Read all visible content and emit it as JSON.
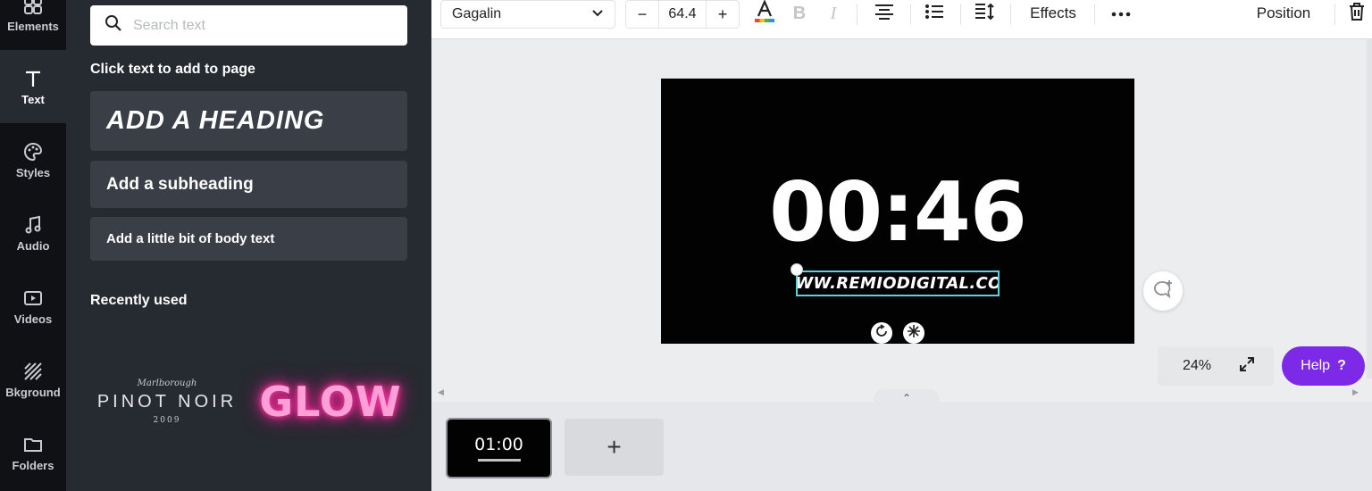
{
  "rail": {
    "items": [
      {
        "label": "Elements",
        "icon": "elements-icon"
      },
      {
        "label": "Text",
        "icon": "text-icon"
      },
      {
        "label": "Styles",
        "icon": "palette-icon"
      },
      {
        "label": "Audio",
        "icon": "music-note-icon"
      },
      {
        "label": "Videos",
        "icon": "video-icon"
      },
      {
        "label": "Bkground",
        "icon": "background-icon"
      },
      {
        "label": "Folders",
        "icon": "folder-icon"
      }
    ],
    "active": "Text"
  },
  "panel": {
    "search_placeholder": "Search text",
    "click_text_heading": "Click text to add to page",
    "add_heading": "ADD A HEADING",
    "add_subheading": "Add a subheading",
    "add_body": "Add a little bit of body text",
    "recently_used": "Recently used",
    "recent_items": {
      "pinot_small": "Marlborough",
      "pinot_big": "PINOT NOIR",
      "pinot_year": "2009",
      "glow": "GLOW"
    }
  },
  "toolbar": {
    "font_name": "Gagalin",
    "font_size": "64.4",
    "effects_label": "Effects",
    "position_label": "Position",
    "text_color_bar": "rainbow"
  },
  "canvas": {
    "timer_text": "00:46",
    "url_text": "WWW.REMIODIGITAL.COM",
    "background_color": "#020202"
  },
  "zoom": {
    "value": "24%"
  },
  "help": {
    "label": "Help",
    "icon_text": "?"
  },
  "timeline": {
    "page_duration": "01:00",
    "add_page_label": "+"
  },
  "colors": {
    "accent": "#7d2ae8",
    "selection": "#5fd0dc",
    "panel_bg": "#262a31",
    "rail_bg": "#0f1114"
  }
}
